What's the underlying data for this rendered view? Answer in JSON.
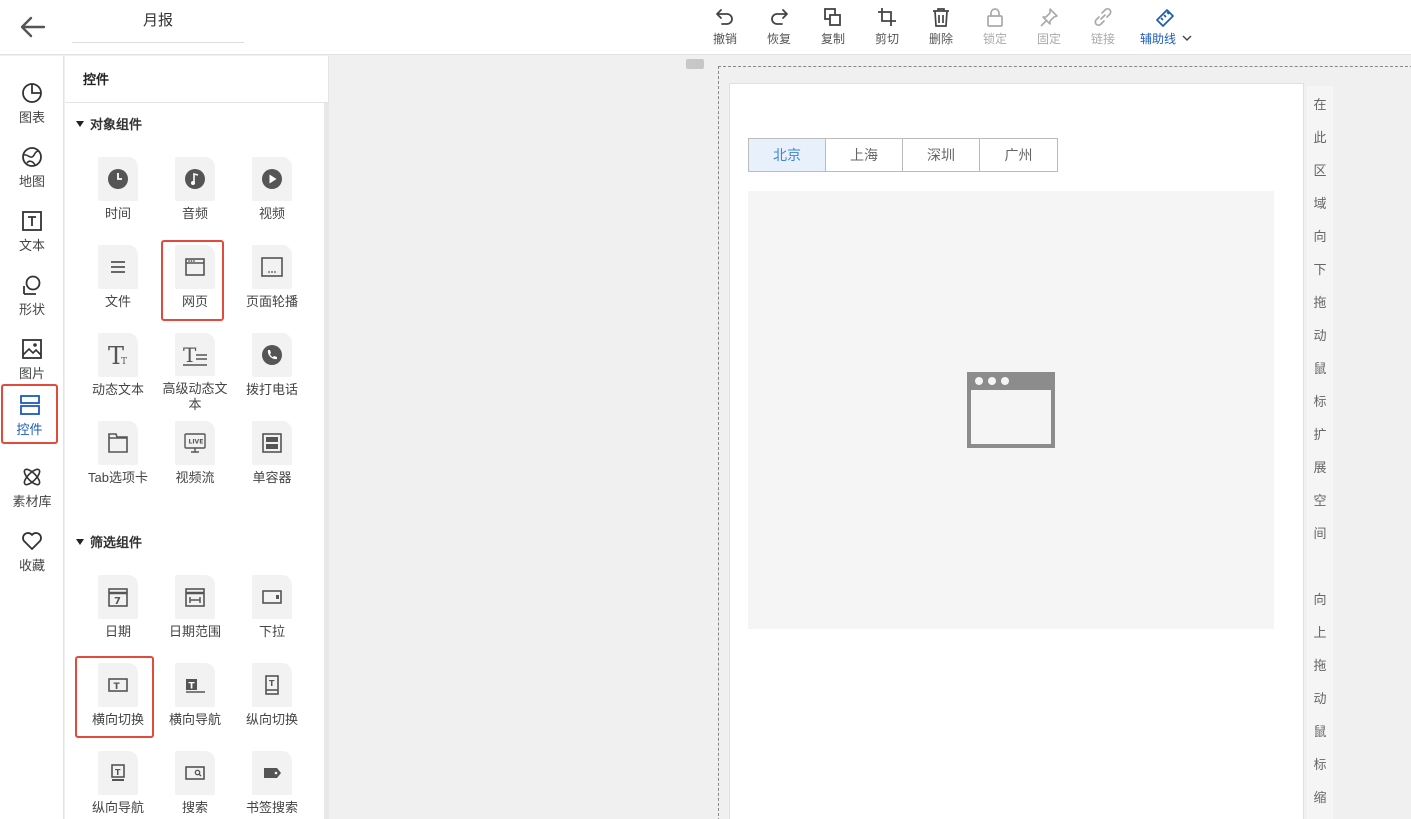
{
  "header": {
    "title": "月报"
  },
  "toolbar": [
    {
      "key": "undo",
      "label": "撤销",
      "state": "normal"
    },
    {
      "key": "redo",
      "label": "恢复",
      "state": "normal"
    },
    {
      "key": "copy",
      "label": "复制",
      "state": "normal"
    },
    {
      "key": "cut",
      "label": "剪切",
      "state": "normal"
    },
    {
      "key": "delete",
      "label": "删除",
      "state": "normal"
    },
    {
      "key": "lock",
      "label": "锁定",
      "state": "disabled"
    },
    {
      "key": "pin",
      "label": "固定",
      "state": "disabled"
    },
    {
      "key": "link",
      "label": "链接",
      "state": "disabled"
    },
    {
      "key": "guide",
      "label": "辅助线",
      "state": "active"
    }
  ],
  "nav": [
    {
      "label": "图表",
      "icon": "pie-chart-icon"
    },
    {
      "label": "地图",
      "icon": "globe-icon"
    },
    {
      "label": "文本",
      "icon": "text-icon"
    },
    {
      "label": "形状",
      "icon": "shape-icon"
    },
    {
      "label": "图片",
      "icon": "image-icon"
    },
    {
      "label": "控件",
      "icon": "widget-icon",
      "active": true
    },
    {
      "label": "素材库",
      "icon": "atom-icon"
    },
    {
      "label": "收藏",
      "icon": "heart-icon"
    }
  ],
  "panel": {
    "title": "控件",
    "sections": [
      {
        "title": "对象组件",
        "items": [
          {
            "label": "时间",
            "icon": "clock-icon"
          },
          {
            "label": "音频",
            "icon": "music-icon"
          },
          {
            "label": "视频",
            "icon": "play-icon"
          },
          {
            "label": "文件",
            "icon": "file-lines-icon"
          },
          {
            "label": "网页",
            "icon": "browser-window-icon",
            "highlighted": true
          },
          {
            "label": "页面轮播",
            "icon": "carousel-icon"
          },
          {
            "label": "动态文本",
            "icon": "dynamic-text-icon"
          },
          {
            "label": "高级动态文本",
            "icon": "advanced-text-icon"
          },
          {
            "label": "拨打电话",
            "icon": "phone-icon"
          },
          {
            "label": "Tab选项卡",
            "icon": "tab-card-icon"
          },
          {
            "label": "视频流",
            "icon": "live-stream-icon"
          },
          {
            "label": "单容器",
            "icon": "container-icon"
          }
        ]
      },
      {
        "title": "筛选组件",
        "items": [
          {
            "label": "日期",
            "icon": "calendar-icon"
          },
          {
            "label": "日期范围",
            "icon": "date-range-icon"
          },
          {
            "label": "下拉",
            "icon": "dropdown-icon"
          },
          {
            "label": "横向切换",
            "icon": "horizontal-switch-icon",
            "highlighted": true
          },
          {
            "label": "横向导航",
            "icon": "horizontal-nav-icon"
          },
          {
            "label": "纵向切换",
            "icon": "vertical-switch-icon"
          },
          {
            "label": "纵向导航",
            "icon": "vertical-nav-icon"
          },
          {
            "label": "搜索",
            "icon": "search-box-icon"
          },
          {
            "label": "书签搜索",
            "icon": "bookmark-search-icon"
          }
        ]
      }
    ]
  },
  "canvas": {
    "tabs": [
      {
        "label": "北京",
        "active": true
      },
      {
        "label": "上海"
      },
      {
        "label": "深圳"
      },
      {
        "label": "广州"
      }
    ],
    "side_hint_down": [
      "在",
      "此",
      "区",
      "域",
      "向",
      "下",
      "拖",
      "动",
      "鼠",
      "标",
      "扩",
      "展",
      "空",
      "间"
    ],
    "side_hint_up": [
      "向",
      "上",
      "拖",
      "动",
      "鼠",
      "标",
      "缩"
    ]
  },
  "colors": {
    "accent": "#1c5cb9",
    "highlight": "#e24a3b",
    "tab_active_text": "#3b86d6"
  }
}
